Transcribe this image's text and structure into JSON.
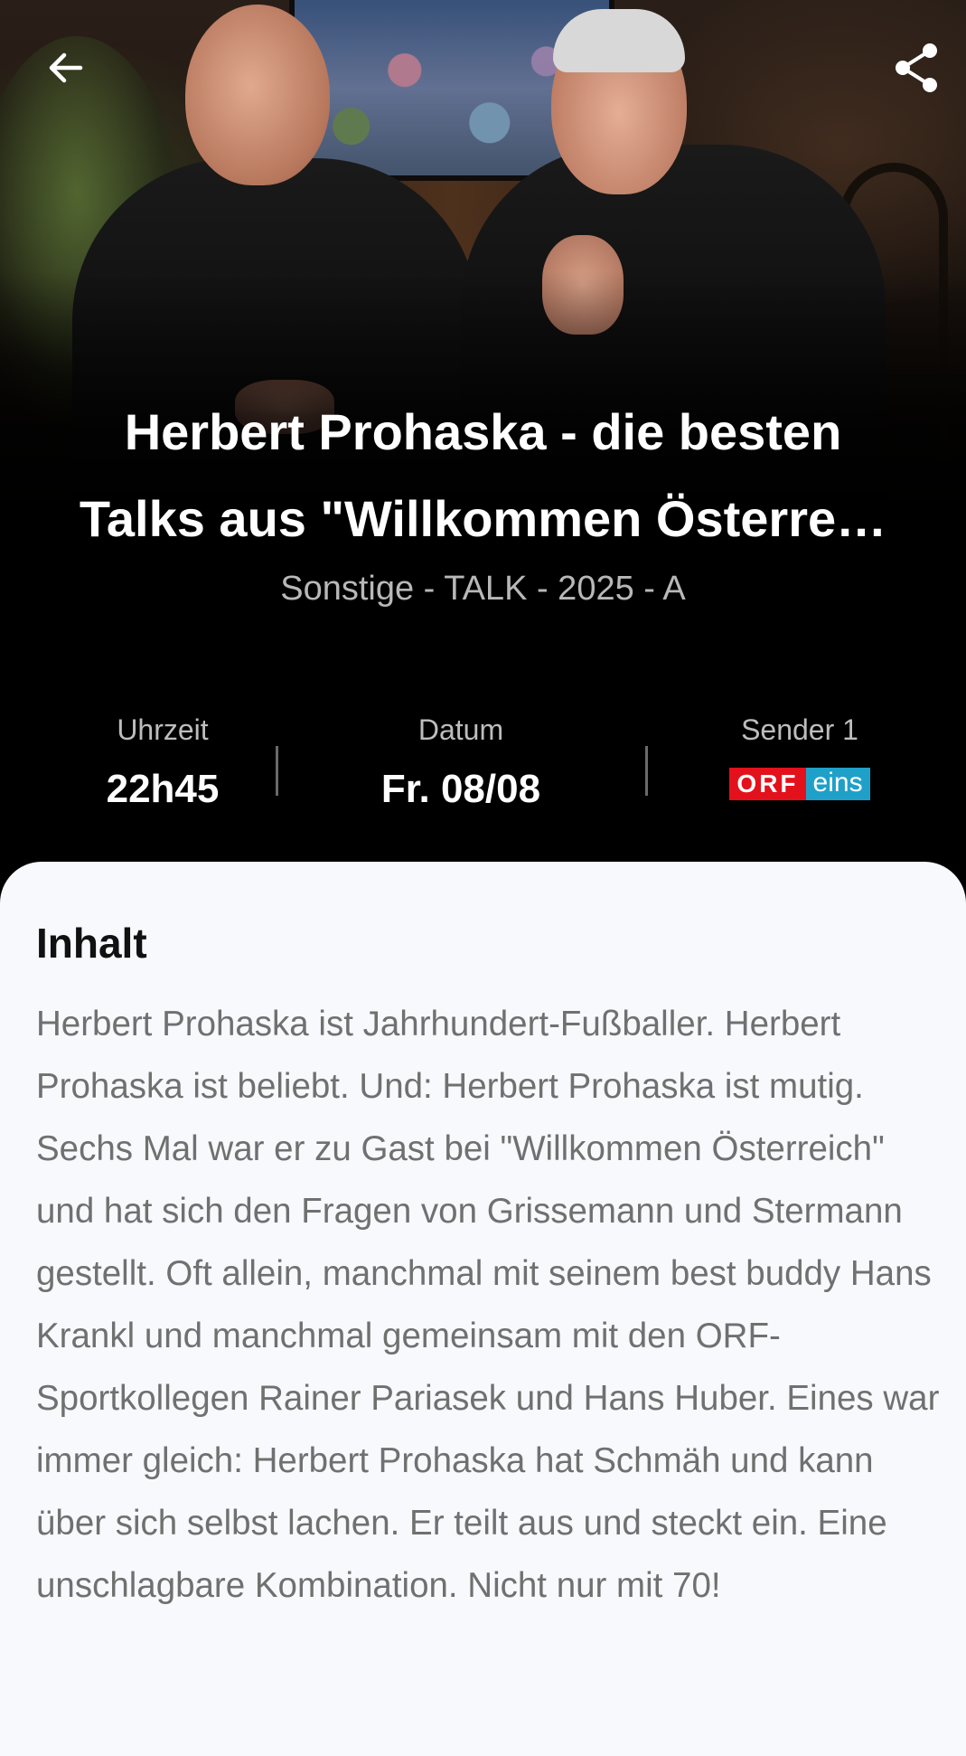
{
  "header": {
    "back_icon": "arrow-left-icon",
    "share_icon": "share-icon"
  },
  "program": {
    "title_line1": "Herbert Prohaska - die besten",
    "title_line2": "Talks aus \"Willkommen Österre…",
    "meta": "Sonstige - TALK - 2025 - A"
  },
  "info": {
    "time_label": "Uhrzeit",
    "time_value": "22h45",
    "date_label": "Datum",
    "date_value": "Fr. 08/08",
    "sender_label": "Sender 1",
    "sender_logo_orf": "ORF",
    "sender_logo_eins": "eins"
  },
  "content": {
    "heading": "Inhalt",
    "body": "Herbert Prohaska ist Jahrhundert-Fußballer. Herbert Prohaska ist beliebt. Und: Herbert Prohaska ist mutig. Sechs Mal war er zu Gast bei \"Willkommen Österreich\" und hat sich den Fragen von Grissemann und Stermann gestellt. Oft allein, manchmal mit seinem best buddy Hans Krankl und manchmal gemeinsam mit den ORF-Sportkollegen Rainer Pariasek und Hans Huber. Eines war immer gleich: Herbert Prohaska hat Schmäh und kann über sich selbst lachen. Er teilt aus und steckt ein. Eine unschlagbare Kombination. Nicht nur mit 70!"
  },
  "colors": {
    "orf_red": "#e3111b",
    "eins_blue": "#1fa0c9",
    "card_bg": "#f8f9fd"
  }
}
